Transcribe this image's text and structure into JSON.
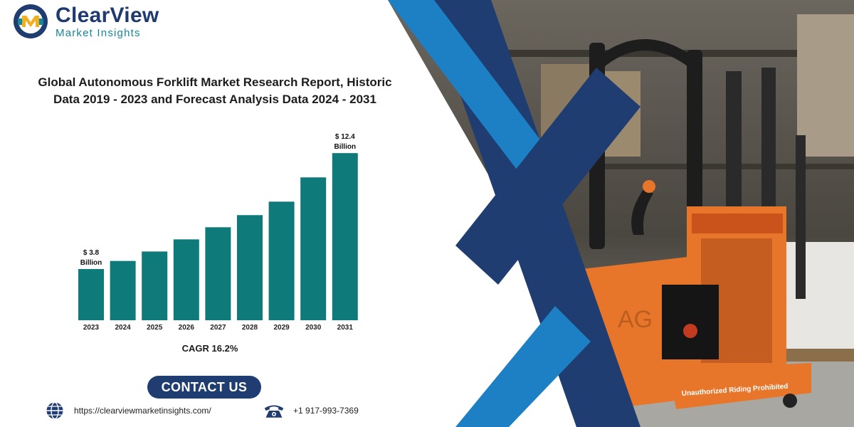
{
  "brand": {
    "name": "ClearView",
    "tagline": "Market Insights"
  },
  "report": {
    "title_line1": "Global Autonomous Forklift Market Research Report, Historic",
    "title_line2": "Data 2019 - 2023 and Forecast Analysis Data 2024 - 2031",
    "cagr": "CAGR 16.2%"
  },
  "chart_data": {
    "type": "bar",
    "categories": [
      "2023",
      "2024",
      "2025",
      "2026",
      "2027",
      "2028",
      "2029",
      "2030",
      "2031"
    ],
    "values": [
      3.8,
      4.4,
      5.1,
      6.0,
      6.9,
      7.8,
      8.8,
      10.6,
      12.4
    ],
    "labeled_values": [
      {
        "category": "2023",
        "line1": "$ 3.8",
        "line2": "Billion"
      },
      {
        "category": "2031",
        "line1": "$ 12.4",
        "line2": "Billion"
      }
    ],
    "ylim": [
      0,
      13.2
    ],
    "grid": false,
    "bar_color": "#0f7a7a"
  },
  "contact": {
    "button_label": "CONTACT US",
    "website": "https://clearviewmarketinsights.com/",
    "phone": "+1 917-993-7369"
  },
  "photo": {
    "panel_text": "Unauthorized Riding Prohibited",
    "badge_text": "AG"
  },
  "colors": {
    "navy": "#1f3d70",
    "blue": "#1d7fc4",
    "teal": "#0f7a7a",
    "forklift_orange": "#e8762a"
  },
  "icons": {
    "logo": "clearview-logo-icon",
    "website": "globe-icon",
    "phone": "telephone-icon"
  }
}
